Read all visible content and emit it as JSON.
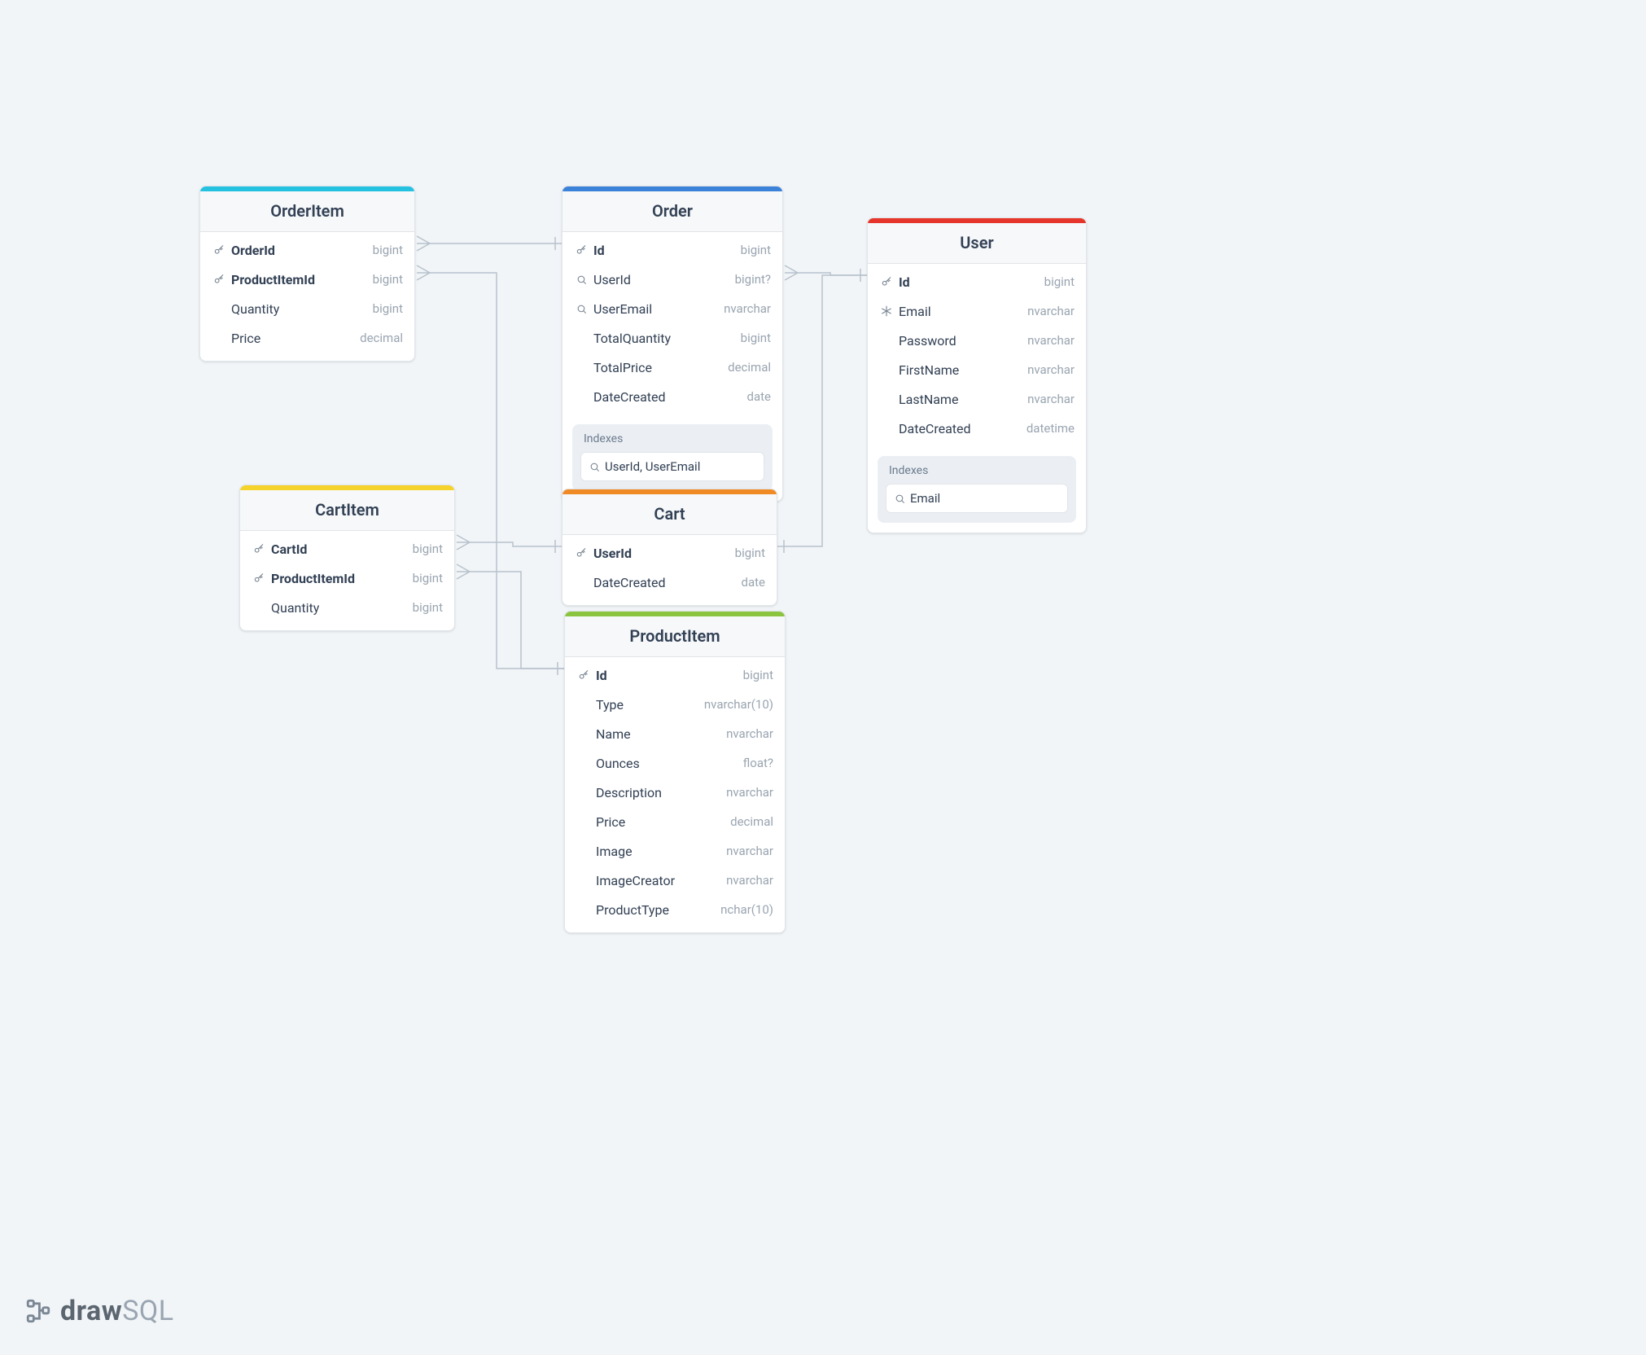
{
  "brand": {
    "first": "draw",
    "second": "SQL"
  },
  "colors": {
    "orderitem": "#25c1e1",
    "order": "#3b82d9",
    "user": "#e6352b",
    "cartitem": "#f5d32b",
    "cart": "#f08a24",
    "productitem": "#8bc53f"
  },
  "indexes_label": "Indexes",
  "tables": {
    "orderitem": {
      "title": "OrderItem",
      "fields": [
        {
          "icon": "key",
          "name": "OrderId",
          "type": "bigint",
          "bold": true
        },
        {
          "icon": "key",
          "name": "ProductItemId",
          "type": "bigint",
          "bold": true
        },
        {
          "icon": "",
          "name": "Quantity",
          "type": "bigint"
        },
        {
          "icon": "",
          "name": "Price",
          "type": "decimal"
        }
      ]
    },
    "order": {
      "title": "Order",
      "fields": [
        {
          "icon": "key",
          "name": "Id",
          "type": "bigint",
          "bold": true
        },
        {
          "icon": "index",
          "name": "UserId",
          "type": "bigint?"
        },
        {
          "icon": "index",
          "name": "UserEmail",
          "type": "nvarchar"
        },
        {
          "icon": "",
          "name": "TotalQuantity",
          "type": "bigint"
        },
        {
          "icon": "",
          "name": "TotalPrice",
          "type": "decimal"
        },
        {
          "icon": "",
          "name": "DateCreated",
          "type": "date"
        }
      ],
      "indexes": [
        "UserId, UserEmail"
      ]
    },
    "user": {
      "title": "User",
      "fields": [
        {
          "icon": "key",
          "name": "Id",
          "type": "bigint",
          "bold": true
        },
        {
          "icon": "snow",
          "name": "Email",
          "type": "nvarchar"
        },
        {
          "icon": "",
          "name": "Password",
          "type": "nvarchar"
        },
        {
          "icon": "",
          "name": "FirstName",
          "type": "nvarchar"
        },
        {
          "icon": "",
          "name": "LastName",
          "type": "nvarchar"
        },
        {
          "icon": "",
          "name": "DateCreated",
          "type": "datetime"
        }
      ],
      "indexes": [
        "Email"
      ]
    },
    "cartitem": {
      "title": "CartItem",
      "fields": [
        {
          "icon": "key",
          "name": "CartId",
          "type": "bigint",
          "bold": true
        },
        {
          "icon": "key",
          "name": "ProductItemId",
          "type": "bigint",
          "bold": true
        },
        {
          "icon": "",
          "name": "Quantity",
          "type": "bigint"
        }
      ]
    },
    "cart": {
      "title": "Cart",
      "fields": [
        {
          "icon": "key",
          "name": "UserId",
          "type": "bigint",
          "bold": true
        },
        {
          "icon": "",
          "name": "DateCreated",
          "type": "date"
        }
      ]
    },
    "productitem": {
      "title": "ProductItem",
      "fields": [
        {
          "icon": "key",
          "name": "Id",
          "type": "bigint",
          "bold": true
        },
        {
          "icon": "",
          "name": "Type",
          "type": "nvarchar(10)"
        },
        {
          "icon": "",
          "name": "Name",
          "type": "nvarchar"
        },
        {
          "icon": "",
          "name": "Ounces",
          "type": "float?"
        },
        {
          "icon": "",
          "name": "Description",
          "type": "nvarchar"
        },
        {
          "icon": "",
          "name": "Price",
          "type": "decimal"
        },
        {
          "icon": "",
          "name": "Image",
          "type": "nvarchar"
        },
        {
          "icon": "",
          "name": "ImageCreator",
          "type": "nvarchar"
        },
        {
          "icon": "",
          "name": "ProductType",
          "type": "nchar(10)"
        }
      ]
    }
  },
  "relations": [
    {
      "from_table": "orderitem",
      "from_field": "OrderId",
      "to_table": "order",
      "to_field": "Id",
      "from_many": true
    },
    {
      "from_table": "orderitem",
      "from_field": "ProductItemId",
      "to_table": "productitem",
      "to_field": "Id",
      "from_many": true
    },
    {
      "from_table": "order",
      "from_field": "UserId",
      "to_table": "user",
      "to_field": "Id",
      "from_many": true
    },
    {
      "from_table": "cartitem",
      "from_field": "CartId",
      "to_table": "cart",
      "to_field": "UserId",
      "from_many": true
    },
    {
      "from_table": "cartitem",
      "from_field": "ProductItemId",
      "to_table": "productitem",
      "to_field": "Id",
      "from_many": true
    },
    {
      "from_table": "cart",
      "from_field": "UserId",
      "to_table": "user",
      "to_field": "Id",
      "from_many": false
    }
  ]
}
